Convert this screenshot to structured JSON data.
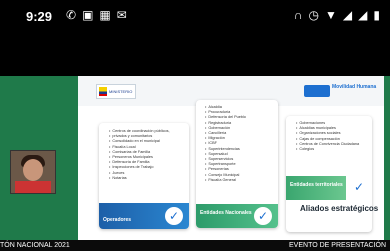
{
  "status_bar": {
    "time": "9:29",
    "left_icons": [
      "whatsapp-icon",
      "photo-icon",
      "gallery-icon",
      "message-icon"
    ],
    "right_icons": [
      "headphones-icon",
      "alarm-icon",
      "wifi-icon",
      "signal-icon",
      "signal-icon-2",
      "battery-icon"
    ]
  },
  "slide": {
    "logo_left_text": "MINISTERIO",
    "logo_right_text": "Movilidad Humana",
    "panel1": {
      "items": [
        "Centros de coordinación públicos,",
        "privados y comunitarios",
        "Consolidado en el municipal",
        "Fiscalía Local",
        "Comisarías de Familia",
        "Personeros Municipales",
        "Defensoría de Familia",
        "Inspecciones de Trabajo",
        "Jueces",
        "Notarías"
      ],
      "bar_label": "Operadores"
    },
    "panel2": {
      "items": [
        "Alcaldía",
        "Procuraduría",
        "Defensoría del Pueblo",
        "Registraduría",
        "Gobernación",
        "Cancillería",
        "Migración",
        "ICBF",
        "Superintendencias",
        "Supersalud",
        "Superservicios",
        "Supertransporte",
        "Personerías",
        "Consejo Municipal",
        "Fiscalía General"
      ],
      "bar_label": "Entidades Nacionales"
    },
    "panel3": {
      "items": [
        "Gobernaciones",
        "Alcaldías municipales",
        "Organizaciones sociales",
        "Cajas de compensación",
        "Centros de Convivencia Ciudadana",
        "Colegios"
      ],
      "bar_label": "Entidades territoriales"
    },
    "aliados_label": "Aliados estratégicos"
  },
  "bottom_bar": {
    "left_text": "TÓN NACIONAL 2021",
    "right_text": "EVENTO DE PRESENTACIÓN"
  },
  "colors": {
    "background_green": "#1f7a4a",
    "blue_bar": "#1d5fa8",
    "green_bar": "#2d9b6a"
  }
}
